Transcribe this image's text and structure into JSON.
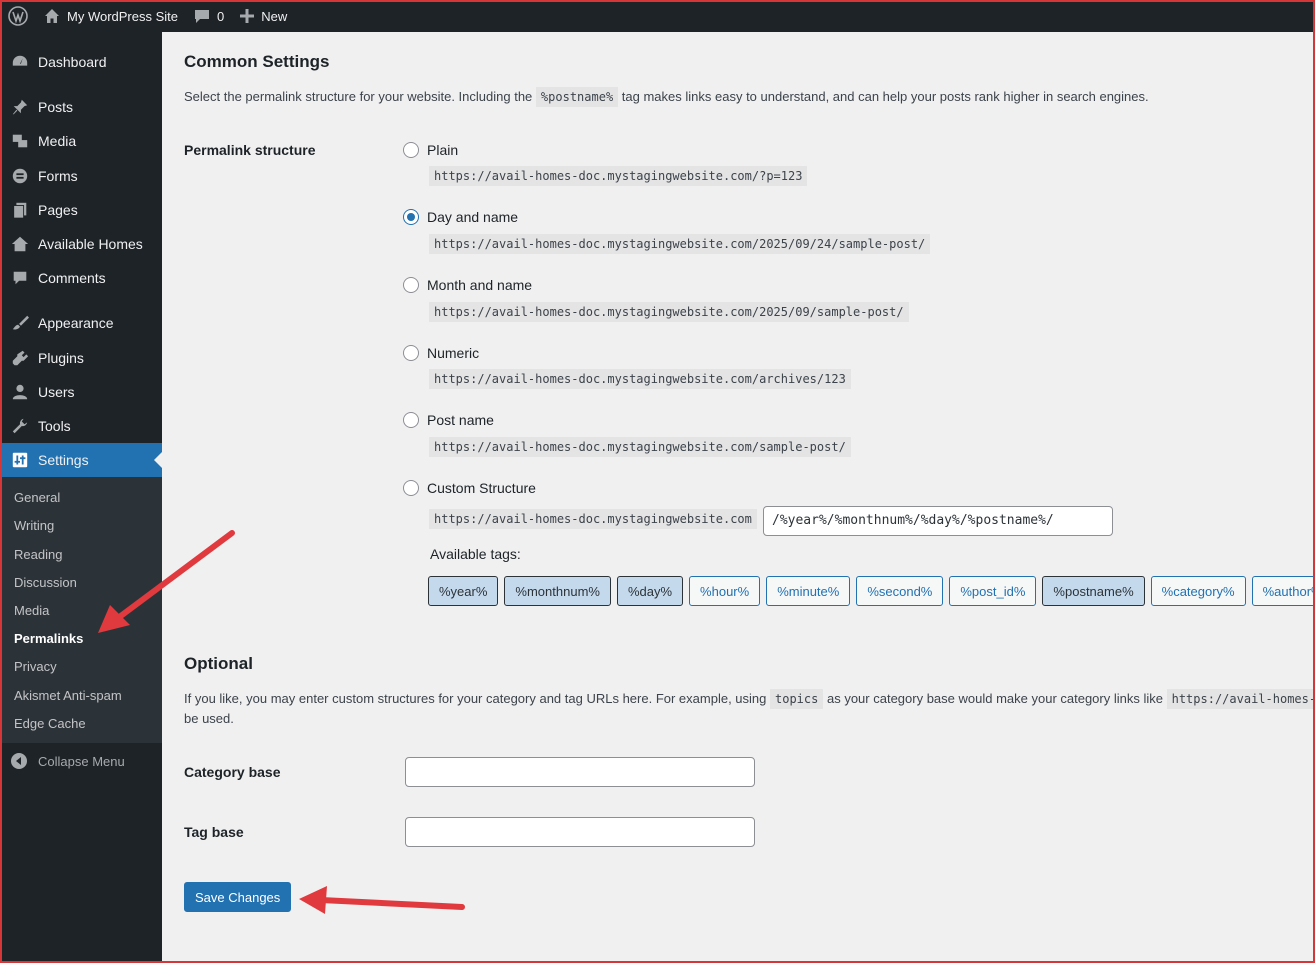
{
  "admin_bar": {
    "site_name": "My WordPress Site",
    "comments_count": "0",
    "new_label": "New"
  },
  "sidebar": {
    "menu": [
      {
        "label": "Dashboard",
        "icon": "dashboard-icon"
      },
      {
        "label": "Posts",
        "icon": "pin-icon"
      },
      {
        "label": "Media",
        "icon": "media-icon"
      },
      {
        "label": "Forms",
        "icon": "forms-icon"
      },
      {
        "label": "Pages",
        "icon": "pages-icon"
      },
      {
        "label": "Available Homes",
        "icon": "homes-icon"
      },
      {
        "label": "Comments",
        "icon": "comment-icon"
      },
      {
        "label": "Appearance",
        "icon": "brush-icon"
      },
      {
        "label": "Plugins",
        "icon": "plug-icon"
      },
      {
        "label": "Users",
        "icon": "user-icon"
      },
      {
        "label": "Tools",
        "icon": "wrench-icon"
      },
      {
        "label": "Settings",
        "icon": "settings-icon"
      }
    ],
    "submenu": [
      "General",
      "Writing",
      "Reading",
      "Discussion",
      "Media",
      "Permalinks",
      "Privacy",
      "Akismet Anti-spam",
      "Edge Cache"
    ],
    "collapse_label": "Collapse Menu"
  },
  "common": {
    "heading": "Common Settings",
    "desc_before": "Select the permalink structure for your website. Including the",
    "desc_code": "%postname%",
    "desc_after": "tag makes links easy to understand, and can help your posts rank higher in search engines.",
    "structure_label": "Permalink structure",
    "options": [
      {
        "label": "Plain",
        "url": "https://avail-homes-doc.mystagingwebsite.com/?p=123",
        "checked": false
      },
      {
        "label": "Day and name",
        "url": "https://avail-homes-doc.mystagingwebsite.com/2025/09/24/sample-post/",
        "checked": true
      },
      {
        "label": "Month and name",
        "url": "https://avail-homes-doc.mystagingwebsite.com/2025/09/sample-post/",
        "checked": false
      },
      {
        "label": "Numeric",
        "url": "https://avail-homes-doc.mystagingwebsite.com/archives/123",
        "checked": false
      },
      {
        "label": "Post name",
        "url": "https://avail-homes-doc.mystagingwebsite.com/sample-post/",
        "checked": false
      }
    ],
    "custom": {
      "label": "Custom Structure",
      "base_url": "https://avail-homes-doc.mystagingwebsite.com",
      "value": "/%year%/%monthnum%/%day%/%postname%/"
    },
    "tags_label": "Available tags:",
    "tags": [
      {
        "label": "%year%",
        "active": true
      },
      {
        "label": "%monthnum%",
        "active": true
      },
      {
        "label": "%day%",
        "active": true
      },
      {
        "label": "%hour%",
        "active": false
      },
      {
        "label": "%minute%",
        "active": false
      },
      {
        "label": "%second%",
        "active": false
      },
      {
        "label": "%post_id%",
        "active": false
      },
      {
        "label": "%postname%",
        "active": true
      },
      {
        "label": "%category%",
        "active": false
      },
      {
        "label": "%author%",
        "active": false
      }
    ]
  },
  "optional": {
    "heading": "Optional",
    "desc_before": "If you like, you may enter custom structures for your category and tag URLs here. For example, using",
    "desc_code": "topics",
    "desc_after": "as your category base would make your category links like",
    "desc_code2": "https://avail-homes-doc.mystagingwebsite.com/topics/uncategorized/",
    "desc_line2": "be used.",
    "category_label": "Category base",
    "category_value": "",
    "tag_label": "Tag base",
    "tag_value": ""
  },
  "save_label": "Save Changes",
  "colors": {
    "accent": "#2271b1",
    "sidebar": "#1d2327",
    "annotation": "#e03a3e"
  }
}
